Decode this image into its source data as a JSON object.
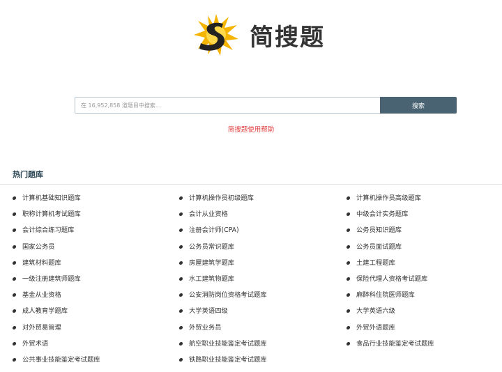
{
  "brand": {
    "name": "简搜题",
    "logo_icon": "sun-s-logo-icon"
  },
  "search": {
    "placeholder": "在 16,952,858 道题目中搜索...",
    "button_label": "搜索"
  },
  "help_link": "简搜题使用帮助",
  "section_title": "热门题库",
  "columns": [
    [
      "计算机基础知识题库",
      "职称计算机考试题库",
      "会计综合练习题库",
      "国家公务员",
      "建筑材料题库",
      "一级注册建筑师题库",
      "基金从业资格",
      "成人教育学题库",
      "对外贸易管理",
      "外贸术语",
      "公共事业技能鉴定考试题库"
    ],
    [
      "计算机操作员初级题库",
      "会计从业资格",
      "注册会计师(CPA)",
      "公务员常识题库",
      "房屋建筑学题库",
      "水工建筑物题库",
      "公安消防岗位资格考试题库",
      "大学英语四级",
      "外贸业务员",
      "航空职业技能鉴定考试题库",
      "铁路职业技能鉴定考试题库"
    ],
    [
      "计算机操作员高级题库",
      "中级会计实务题库",
      "公务员知识题库",
      "公务员面试题库",
      "土建工程题库",
      "保险代理人资格考试题库",
      "麻醉科住院医师题库",
      "大学英语六级",
      "外贸外语题库",
      "食品行业技能鉴定考试题库"
    ]
  ]
}
